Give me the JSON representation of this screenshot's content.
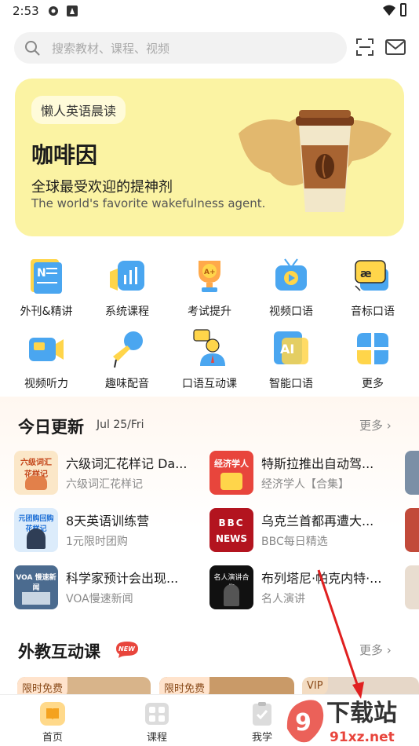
{
  "status_bar": {
    "time": "2:53"
  },
  "search": {
    "placeholder": "搜索教材、课程、视频"
  },
  "banner": {
    "chip": "懒人英语晨读",
    "title": "咖啡因",
    "subtitle": "全球最受欢迎的提神剂",
    "english": "The world's favorite wakefulness agent."
  },
  "grid": [
    {
      "label": "外刊&精讲",
      "icon": "newspaper-icon"
    },
    {
      "label": "系统课程",
      "icon": "chart-icon"
    },
    {
      "label": "考试提升",
      "icon": "trophy-icon"
    },
    {
      "label": "视频口语",
      "icon": "tv-icon"
    },
    {
      "label": "音标口语",
      "icon": "phonetic-icon"
    },
    {
      "label": "视频听力",
      "icon": "camera-icon"
    },
    {
      "label": "趣味配音",
      "icon": "microphone-icon"
    },
    {
      "label": "口语互动课",
      "icon": "teacher-icon"
    },
    {
      "label": "智能口语",
      "icon": "ai-icon"
    },
    {
      "label": "更多",
      "icon": "clover-icon"
    }
  ],
  "updates": {
    "title": "今日更新",
    "date": "Jul 25/Fri",
    "more": "更多",
    "cards": [
      {
        "title": "六级词汇花样记 Da...",
        "sub": "六级词汇花样记",
        "thumb_text": "六级词汇 花样记"
      },
      {
        "title": "特斯拉推出自动驾...",
        "sub": "经济学人【合集】",
        "thumb_text": "经济学人"
      },
      {
        "title": "8天英语训练营",
        "sub": "1元限时团购",
        "thumb_text": "元团购回购 花样记"
      },
      {
        "title": "乌克兰首都再遭大...",
        "sub": "BBC每日精选",
        "thumb_text_1": "BBC",
        "thumb_text_2": "NEWS"
      },
      {
        "title": "科学家预计会出现...",
        "sub": "VOA慢速新闻",
        "thumb_text": "VOA 慢速新闻"
      },
      {
        "title": "布列塔尼·帕克内特·...",
        "sub": "名人演讲",
        "thumb_text": "名人演讲合集"
      }
    ]
  },
  "foreign": {
    "title": "外教互动课",
    "badge": "NEW",
    "more": "更多",
    "cards": [
      {
        "tag": "限时免费"
      },
      {
        "tag": "限时免费"
      },
      {
        "tag": "VIP"
      }
    ]
  },
  "nav": [
    {
      "label": "首页",
      "icon": "home-icon"
    },
    {
      "label": "课程",
      "icon": "course-icon"
    },
    {
      "label": "我学",
      "icon": "clipboard-icon"
    }
  ],
  "watermark": {
    "line1": "下载站",
    "line2": "91xz.net"
  },
  "colors": {
    "banner_bg": "#fbf3a3",
    "accent_red": "#e8453c",
    "grid_blue": "#4aa6f0",
    "grid_yellow": "#ffd54a"
  }
}
